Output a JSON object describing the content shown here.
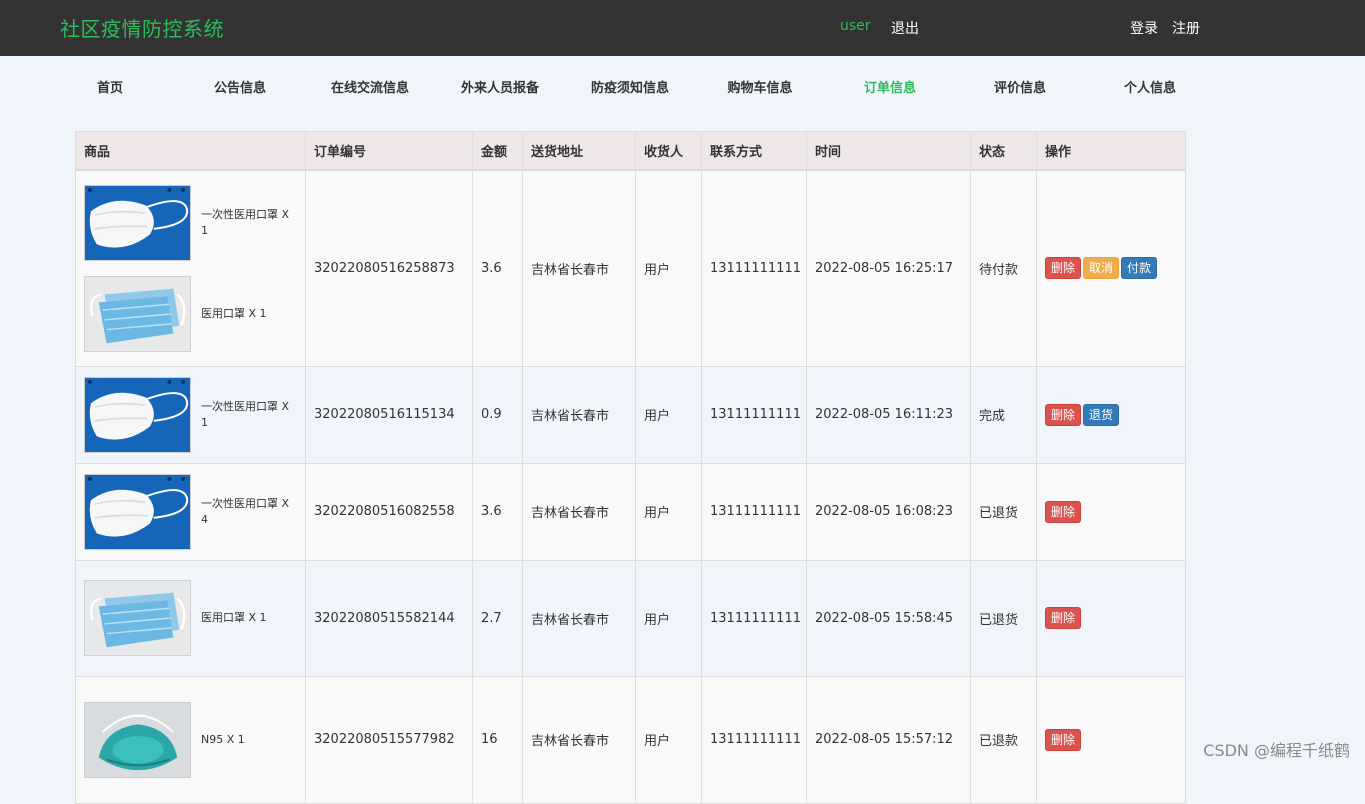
{
  "header": {
    "brand": "社区疫情防控系统",
    "user": "user",
    "logout": "退出",
    "login": "登录",
    "register": "注册"
  },
  "nav": [
    {
      "label": "首页",
      "active": false
    },
    {
      "label": "公告信息",
      "active": false
    },
    {
      "label": "在线交流信息",
      "active": false
    },
    {
      "label": "外来人员报备",
      "active": false
    },
    {
      "label": "防疫须知信息",
      "active": false
    },
    {
      "label": "购物车信息",
      "active": false
    },
    {
      "label": "订单信息",
      "active": true
    },
    {
      "label": "评价信息",
      "active": false
    },
    {
      "label": "个人信息",
      "active": false
    }
  ],
  "table": {
    "headers": [
      "商品",
      "订单编号",
      "金额",
      "送货地址",
      "收货人",
      "联系方式",
      "时间",
      "状态",
      "操作"
    ],
    "rows": [
      {
        "items": [
          {
            "name": "一次性医用口罩 X 1",
            "image": "kn95-mask-image"
          },
          {
            "name": "医用口罩 X 1",
            "image": "surgical-mask-image"
          }
        ],
        "order_no": "32022080516258873",
        "amount": "3.6",
        "address": "吉林省长春市",
        "receiver": "用户",
        "phone": "13111111111",
        "time": "2022-08-05 16:25:17",
        "status": "待付款",
        "actions": [
          {
            "label": "删除",
            "style": "danger"
          },
          {
            "label": "取消",
            "style": "warning"
          },
          {
            "label": "付款",
            "style": "primary"
          }
        ]
      },
      {
        "items": [
          {
            "name": "一次性医用口罩 X 1",
            "image": "kn95-mask-image"
          }
        ],
        "order_no": "32022080516115134",
        "amount": "0.9",
        "address": "吉林省长春市",
        "receiver": "用户",
        "phone": "13111111111",
        "time": "2022-08-05 16:11:23",
        "status": "完成",
        "actions": [
          {
            "label": "删除",
            "style": "danger"
          },
          {
            "label": "退货",
            "style": "primary"
          }
        ]
      },
      {
        "items": [
          {
            "name": "一次性医用口罩 X 4",
            "image": "kn95-mask-image"
          }
        ],
        "order_no": "32022080516082558",
        "amount": "3.6",
        "address": "吉林省长春市",
        "receiver": "用户",
        "phone": "13111111111",
        "time": "2022-08-05 16:08:23",
        "status": "已退货",
        "actions": [
          {
            "label": "删除",
            "style": "danger"
          }
        ]
      },
      {
        "items": [
          {
            "name": "医用口罩 X 1",
            "image": "surgical-mask-image"
          }
        ],
        "order_no": "32022080515582144",
        "amount": "2.7",
        "address": "吉林省长春市",
        "receiver": "用户",
        "phone": "13111111111",
        "time": "2022-08-05 15:58:45",
        "status": "已退货",
        "actions": [
          {
            "label": "删除",
            "style": "danger"
          }
        ]
      },
      {
        "items": [
          {
            "name": "N95 X 1",
            "image": "n95-mask-image"
          }
        ],
        "order_no": "32022080515577982",
        "amount": "16",
        "address": "吉林省长春市",
        "receiver": "用户",
        "phone": "13111111111",
        "time": "2022-08-05 15:57:12",
        "status": "已退款",
        "actions": [
          {
            "label": "删除",
            "style": "danger"
          }
        ]
      }
    ]
  },
  "watermark": "CSDN @编程千纸鹤",
  "colors": {
    "topbar": "#333333",
    "accent_green": "#2dbd59",
    "page_background": "#f0f5fc",
    "header_row": "#efe6e8",
    "danger": "#d9534f",
    "warning": "#f0ad4e",
    "primary": "#337ab7"
  }
}
